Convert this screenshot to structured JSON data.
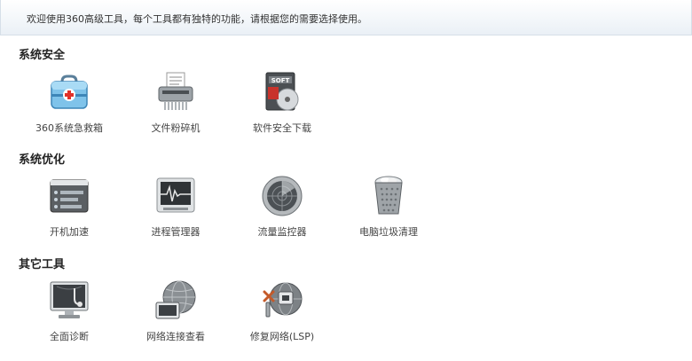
{
  "banner": {
    "text": "欢迎使用360高级工具，每个工具都有独特的功能，请根据您的需要选择使用。"
  },
  "sections": [
    {
      "title": "系统安全",
      "tools": [
        {
          "label": "360系统急救箱",
          "icon": "first-aid-kit-icon"
        },
        {
          "label": "文件粉碎机",
          "icon": "shredder-icon"
        },
        {
          "label": "软件安全下载",
          "icon": "software-download-icon"
        }
      ]
    },
    {
      "title": "系统优化",
      "tools": [
        {
          "label": "开机加速",
          "icon": "startup-speed-icon"
        },
        {
          "label": "进程管理器",
          "icon": "process-monitor-icon"
        },
        {
          "label": "流量监控器",
          "icon": "traffic-radar-icon"
        },
        {
          "label": "电脑垃圾清理",
          "icon": "trash-can-icon"
        }
      ]
    },
    {
      "title": "其它工具",
      "tools": [
        {
          "label": "全面诊断",
          "icon": "diagnosis-monitor-icon"
        },
        {
          "label": "网络连接查看",
          "icon": "network-globe-icon"
        },
        {
          "label": "修复网络(LSP)",
          "icon": "network-repair-icon"
        }
      ]
    }
  ]
}
